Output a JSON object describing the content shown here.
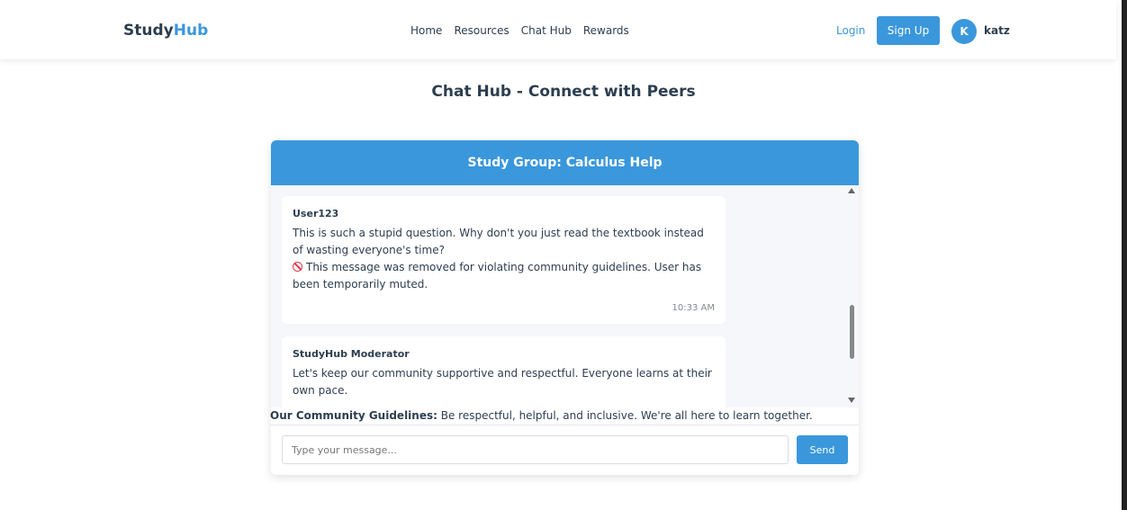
{
  "navbar": {
    "brand_part1": "Study",
    "brand_part2": "Hub",
    "links": [
      "Home",
      "Resources",
      "Chat Hub",
      "Rewards"
    ],
    "login_label": "Login",
    "signup_label": "Sign Up",
    "avatar_initial": "K",
    "username": "katz"
  },
  "page": {
    "title": "Chat Hub - Connect with Peers"
  },
  "chat": {
    "group_title": "Study Group: Calculus Help",
    "messages": [
      {
        "author": "User123",
        "text": "This is such a stupid question. Why don't you just read the textbook instead of wasting everyone's time?",
        "removed_notice": "This message was removed for violating community guidelines. User has been temporarily muted.",
        "time": "10:33 AM"
      },
      {
        "author": "StudyHub Moderator",
        "text": "Let's keep our community supportive and respectful. Everyone learns at their own pace."
      }
    ],
    "guidelines_label": "Our Community Guidelines:",
    "guidelines_text": " Be respectful, helpful, and inclusive. We're all here to learn together.",
    "input_placeholder": "Type your message...",
    "send_label": "Send"
  },
  "colors": {
    "accent": "#3a97dc",
    "text": "#2c3e50",
    "removed_icon": "#e0394b"
  }
}
